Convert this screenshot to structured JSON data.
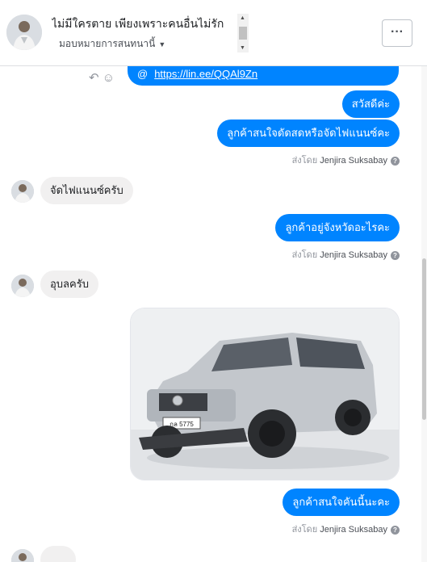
{
  "header": {
    "title": "ไม่มีใครตาย เพียงเพราะคนอื่นไม่รัก",
    "assign_label": "มอบหมายการสนทนานี้",
    "more_label": "···"
  },
  "messages": {
    "link_prefix": "@",
    "link_url": "https://lin.ee/QQAl9Zn",
    "greeting": "สวัสดีค่ะ",
    "question_1": "ลูกค้าสนใจดัดสดหรือจัดไฟแนนซ์คะ",
    "reply_1": "จัดไฟแนนซ์ครับ",
    "question_2": "ลูกค้าอยู่จังหวัดอะไรคะ",
    "reply_2": "อุบลครับ",
    "question_3": "ลูกค้าสนใจคันนี้นะคะ"
  },
  "sent_by": {
    "prefix": "ส่งโดย",
    "name": "Jenjira Suksabay",
    "help": "?"
  },
  "photo": {
    "plate_text": "กล 5775"
  },
  "colors": {
    "outgoing": "#0084ff",
    "incoming": "#f1f0f0"
  }
}
